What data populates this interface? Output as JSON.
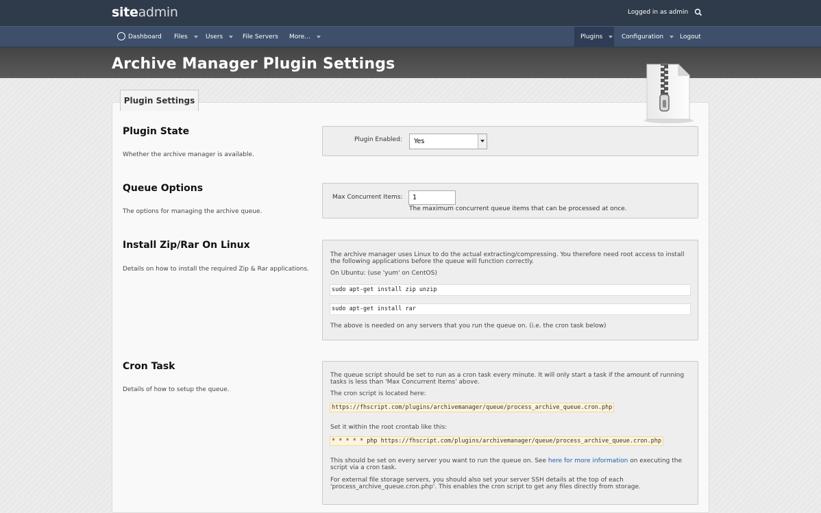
{
  "brand": {
    "bold": "site",
    "light": "admin"
  },
  "header": {
    "logged_in_text": "Logged in as admin"
  },
  "nav": {
    "dashboard": "Dashboard",
    "files": "Files",
    "users": "Users",
    "file_servers": "File Servers",
    "more": "More...",
    "plugins": "Plugins",
    "configuration": "Configuration",
    "logout": "Logout"
  },
  "page": {
    "title": "Archive Manager Plugin Settings",
    "tab": "Plugin Settings"
  },
  "sections": {
    "plugin_state": {
      "title": "Plugin State",
      "desc": "Whether the archive manager is available.",
      "label": "Plugin Enabled:",
      "value": "Yes"
    },
    "queue_options": {
      "title": "Queue Options",
      "desc": "The options for managing the archive queue.",
      "label": "Max Concurrent Items:",
      "value": "1",
      "help": "The maximum concurrent queue items that can be processed at once."
    },
    "install": {
      "title": "Install Zip/Rar On Linux",
      "desc": "Details on how to install the required Zip & Rar applications.",
      "intro": "The archive manager uses Linux to do the actual extracting/compressing. You therefore need root access to install the following applications before the queue will function correctly.",
      "ubuntu_note": "On Ubuntu: (use 'yum' on CentOS)",
      "cmd1": "sudo apt-get install zip unzip",
      "cmd2": "sudo apt-get install rar",
      "footer": "The above is needed on any servers that you run the queue on. (i.e. the cron task below)"
    },
    "cron": {
      "title": "Cron Task",
      "desc": "Details of how to setup the queue.",
      "p1": "The queue script should be set to run as a cron task every minute. It will only start a task if the amount of running tasks is less than 'Max Concurrent Items' above.",
      "p2": "The cron script is located here:",
      "script_url": "https://fhscript.com/plugins/archivemanager/queue/process_archive_queue.cron.php",
      "p3": "Set it within the root crontab like this:",
      "crontab": "* * * * * php https://fhscript.com/plugins/archivemanager/queue/process_archive_queue.cron.php",
      "p4_before": "This should be set on every server you want to run the queue on. See ",
      "p4_link": "here for more information",
      "p4_after": " on executing the script via a cron task.",
      "p5": "For external file storage servers, you should also set your server SSH details at the top of each 'process_archive_queue.cron.php'. This enables the cron script to get any files directly from storage."
    }
  }
}
